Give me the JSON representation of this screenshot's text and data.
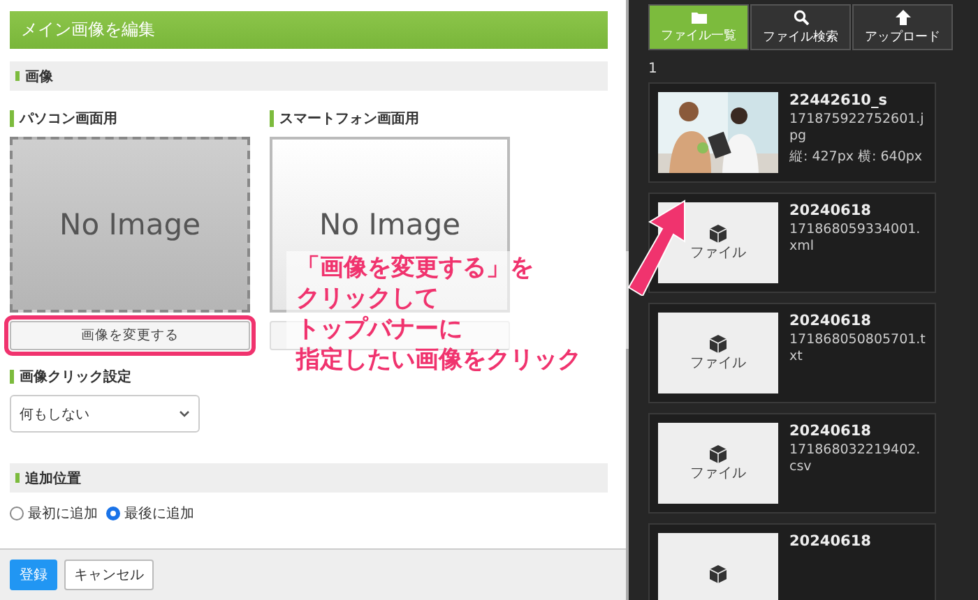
{
  "dialog": {
    "title": "メイン画像を編集",
    "image_section": {
      "title": "画像",
      "slots": [
        {
          "label": "パソコン画面用",
          "preview_text": "No Image",
          "button": "画像を変更する",
          "highlighted": true,
          "filled": true
        },
        {
          "label": "スマートフォン画面用",
          "preview_text": "No Image",
          "highlighted": false,
          "filled": false
        }
      ],
      "click_setting": {
        "label": "画像クリック設定",
        "value": "何もしない"
      }
    },
    "position_section": {
      "title": "追加位置",
      "options": [
        {
          "label": "最初に追加",
          "selected": false
        },
        {
          "label": "最後に追加",
          "selected": true
        }
      ]
    },
    "footer": {
      "buttons": [
        {
          "label": "登録",
          "kind": "primary"
        },
        {
          "label": "キャンセル",
          "kind": "secondary"
        }
      ]
    }
  },
  "file_panel": {
    "tabs": [
      {
        "label": "ファイル一覧",
        "selected": true
      },
      {
        "label": "ファイル検索",
        "selected": false
      },
      {
        "label": "アップロード",
        "selected": false
      }
    ],
    "page": "1",
    "files": [
      {
        "kind": "picture",
        "name": "22442610_s",
        "filename": "171875922752601.jpg",
        "size": "縦: 427px 横: 640px"
      },
      {
        "kind": "file",
        "thumb_label": "ファイル",
        "name": "20240618",
        "filename": "171868059334001.xml"
      },
      {
        "kind": "file",
        "thumb_label": "ファイル",
        "name": "20240618",
        "filename": "171868050805701.txt"
      },
      {
        "kind": "file",
        "thumb_label": "ファイル",
        "name": "20240618",
        "filename": "171868032219402.csv"
      },
      {
        "kind": "file",
        "name": "20240618"
      }
    ]
  },
  "annotation": {
    "lines": [
      "「画像を変更する」を",
      "クリックして",
      "トップバナーに",
      "指定したい画像をクリック"
    ]
  }
}
